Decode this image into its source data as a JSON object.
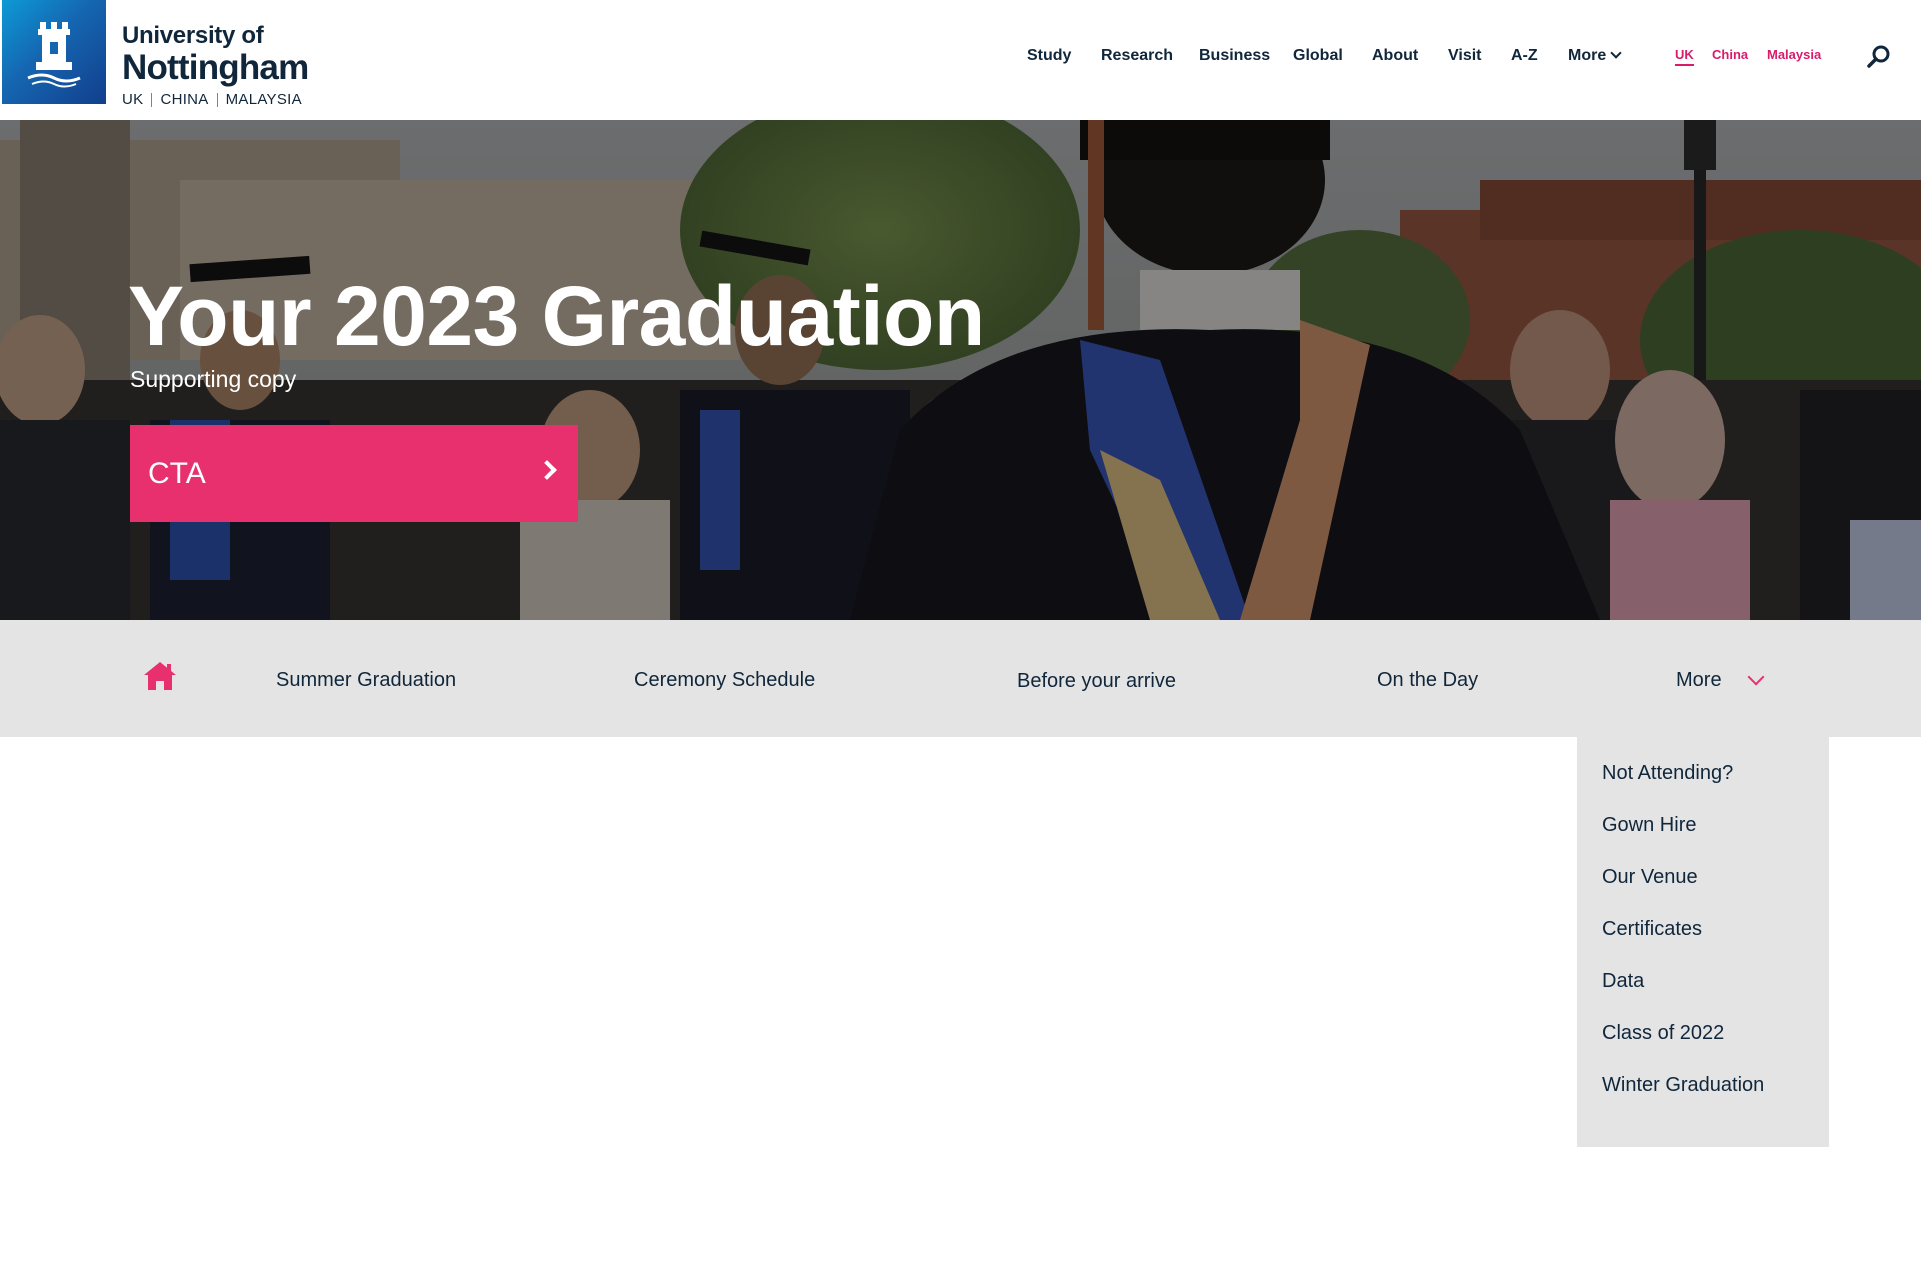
{
  "header": {
    "logo": {
      "line1": "University of",
      "line2": "Nottingham",
      "campuses": [
        "UK",
        "CHINA",
        "MALAYSIA"
      ]
    },
    "nav": [
      "Study",
      "Research",
      "Business",
      "Global",
      "About",
      "Visit",
      "A-Z",
      "More"
    ],
    "campus_links": [
      "UK",
      "China",
      "Malaysia"
    ],
    "active_campus": "UK",
    "search_icon": "search-icon"
  },
  "hero": {
    "title": "Your 2023 Graduation",
    "subtitle": "Supporting copy",
    "cta_label": "CTA"
  },
  "subnav": {
    "home_icon": "home-icon",
    "items": [
      "Summer Graduation",
      "Ceremony Schedule",
      "Before your arrive",
      "On the Day",
      "More"
    ]
  },
  "dropdown": {
    "items": [
      "Not Attending?",
      "Gown Hire",
      "Our Venue",
      "Certificates",
      "Data",
      "Class of 2022",
      "Winter Graduation"
    ]
  },
  "colors": {
    "navy": "#10263b",
    "pink": "#e8306e",
    "campus_pink": "#d91b6c",
    "subnav_bg": "#e4e4e4"
  }
}
